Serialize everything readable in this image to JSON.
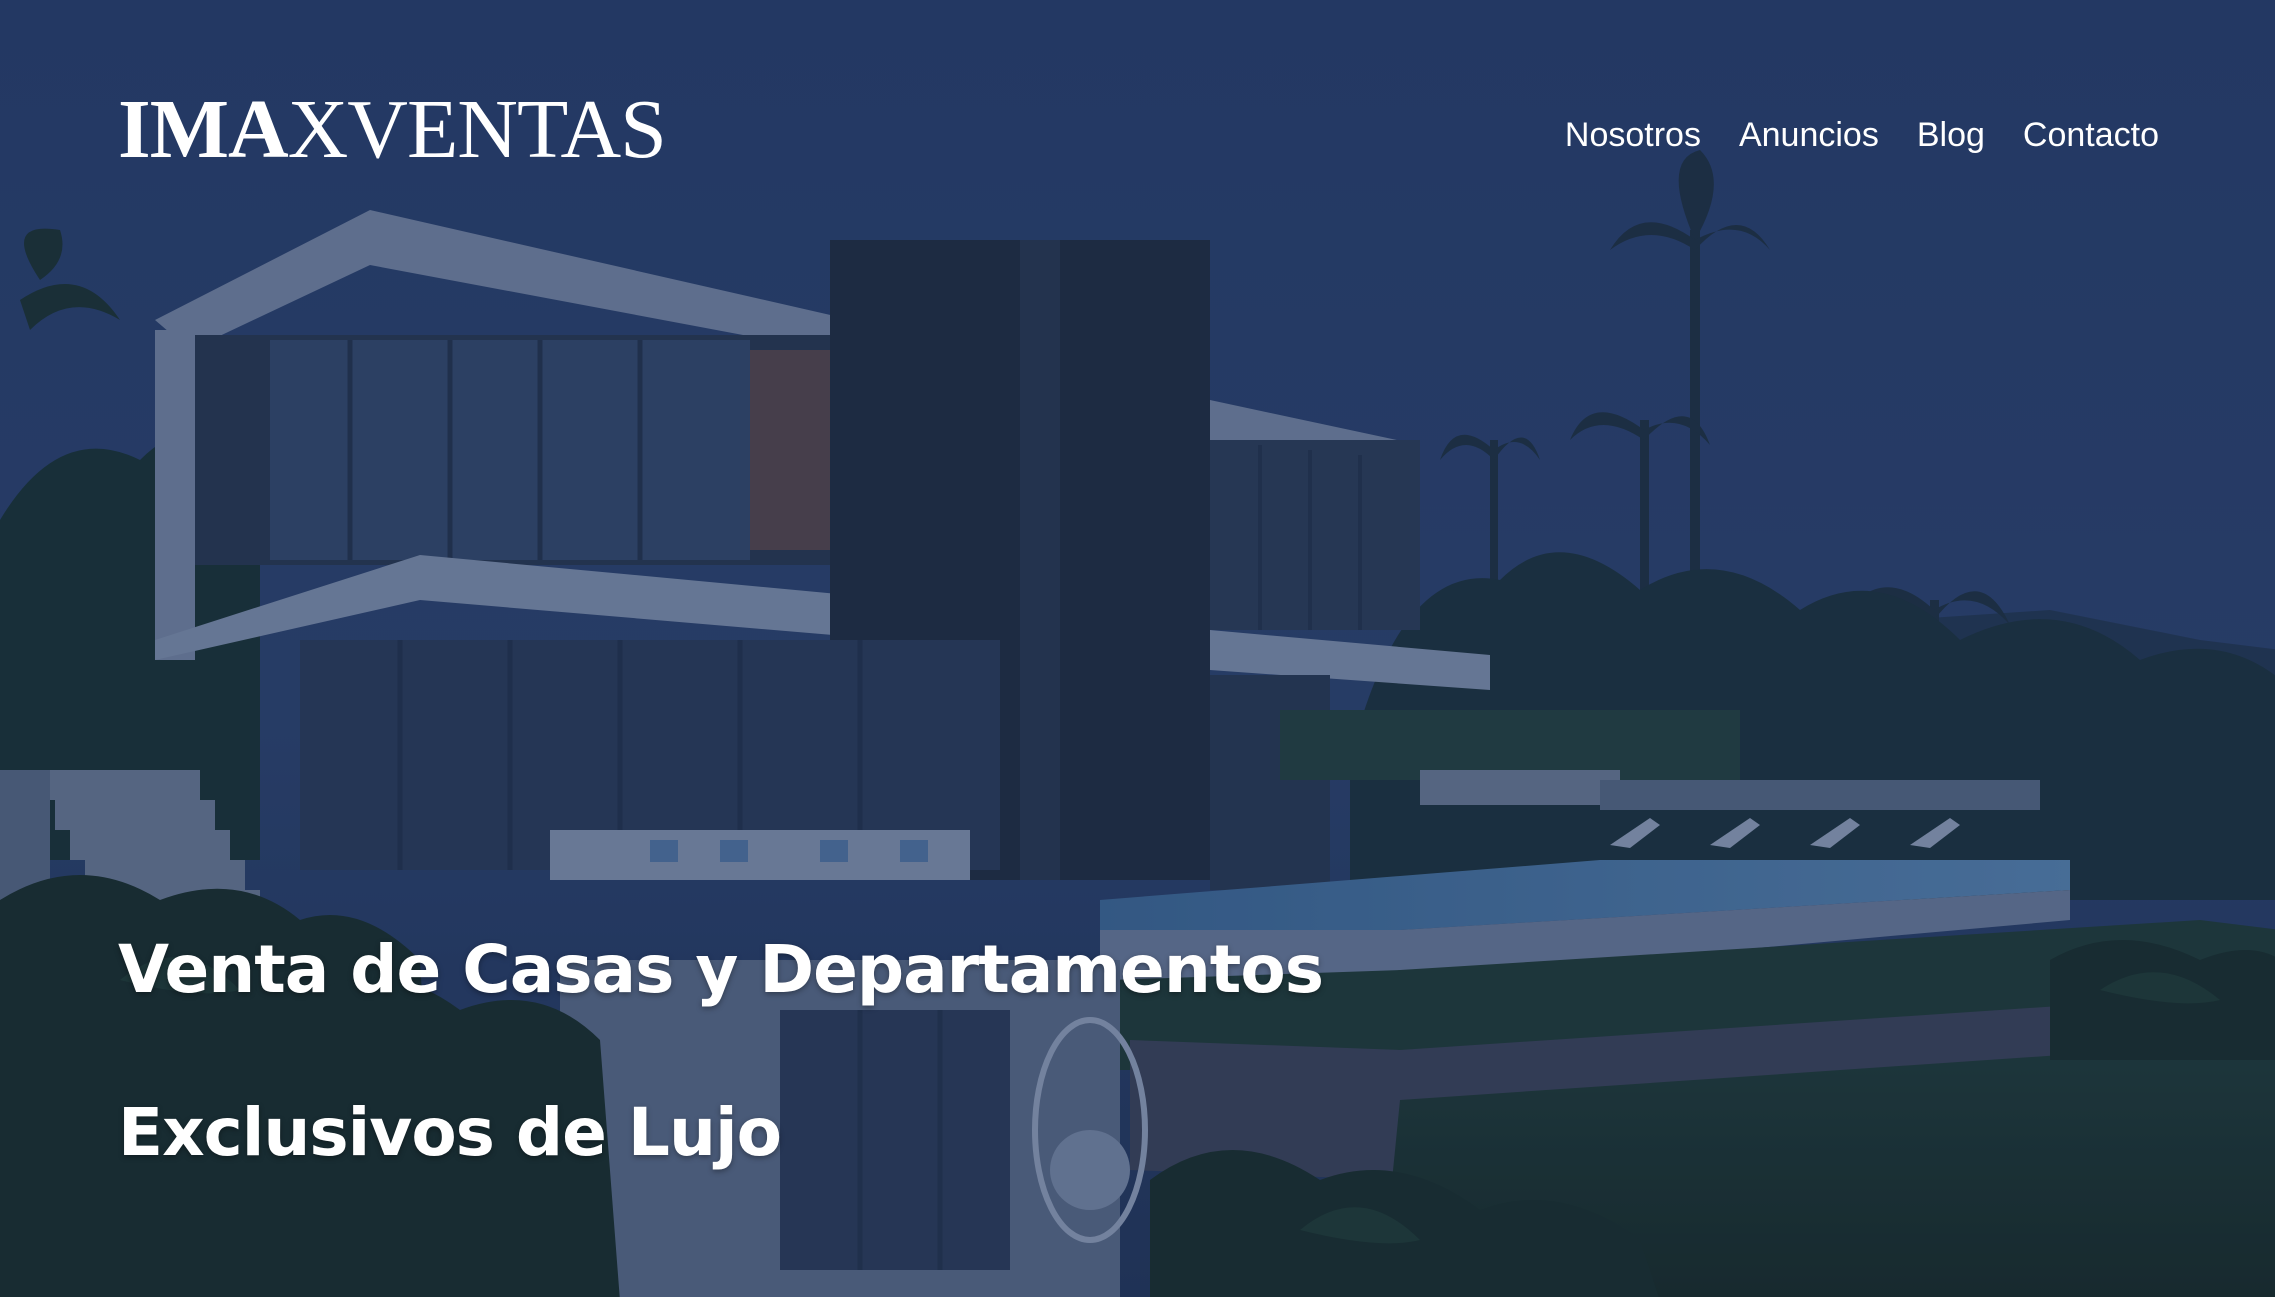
{
  "brand": {
    "logo_bold": "IMA",
    "logo_regular": "XVENTAS"
  },
  "nav": {
    "items": [
      {
        "label": "Nosotros"
      },
      {
        "label": "Anuncios"
      },
      {
        "label": "Blog"
      },
      {
        "label": "Contacto"
      }
    ]
  },
  "hero": {
    "headline_line1": "Venta de Casas y Departamentos",
    "headline_line2": "Exclusivos de Lujo",
    "background_image": "modern-villa-night-photo",
    "overlay_color": "#1c2e54"
  }
}
